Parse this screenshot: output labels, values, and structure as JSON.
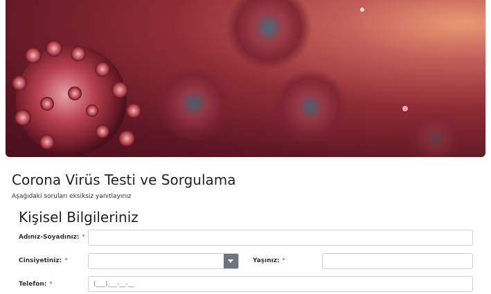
{
  "hero": {
    "image": "coronavirus-illustration"
  },
  "form": {
    "title": "Corona Virüs Testi ve Sorgulama",
    "subtitle": "Aşağıdaki soruları eksiksiz yanıtlayınız",
    "section_title": "Kişisel Bilgileriniz",
    "required_mark": "*",
    "fields": {
      "name": {
        "label": "Adınız-Soyadınız:",
        "value": ""
      },
      "gender": {
        "label": "Cinsiyetiniz:",
        "value": ""
      },
      "age": {
        "label": "Yaşınız:",
        "value": ""
      },
      "phone": {
        "label": "Telefon:",
        "value": "",
        "placeholder": "(___)___-__-__"
      }
    }
  },
  "colors": {
    "select_button": "#6c757d",
    "input_border": "#cfcfcf"
  }
}
